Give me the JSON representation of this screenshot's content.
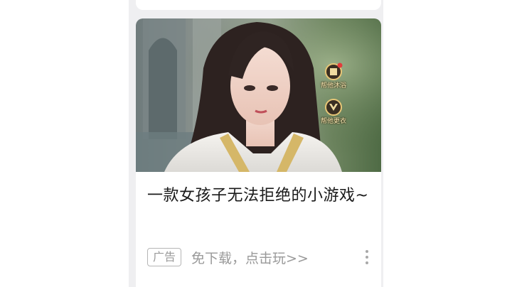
{
  "ad_card": {
    "image": {
      "description_icon_1": "bath-icon",
      "button_1_label": "帮他沐浴",
      "description_icon_2": "outfit-icon",
      "button_2_label": "帮他更衣"
    },
    "title": "一款女孩子无法拒绝的小游戏~",
    "badge": "广告",
    "cta": "免下载，点击玩>>",
    "more_icon": "more-vertical-icon"
  },
  "colors": {
    "page_bg": "#ffffff",
    "feed_bg": "#efeff1",
    "title": "#1a1a1a",
    "meta": "#999999"
  }
}
